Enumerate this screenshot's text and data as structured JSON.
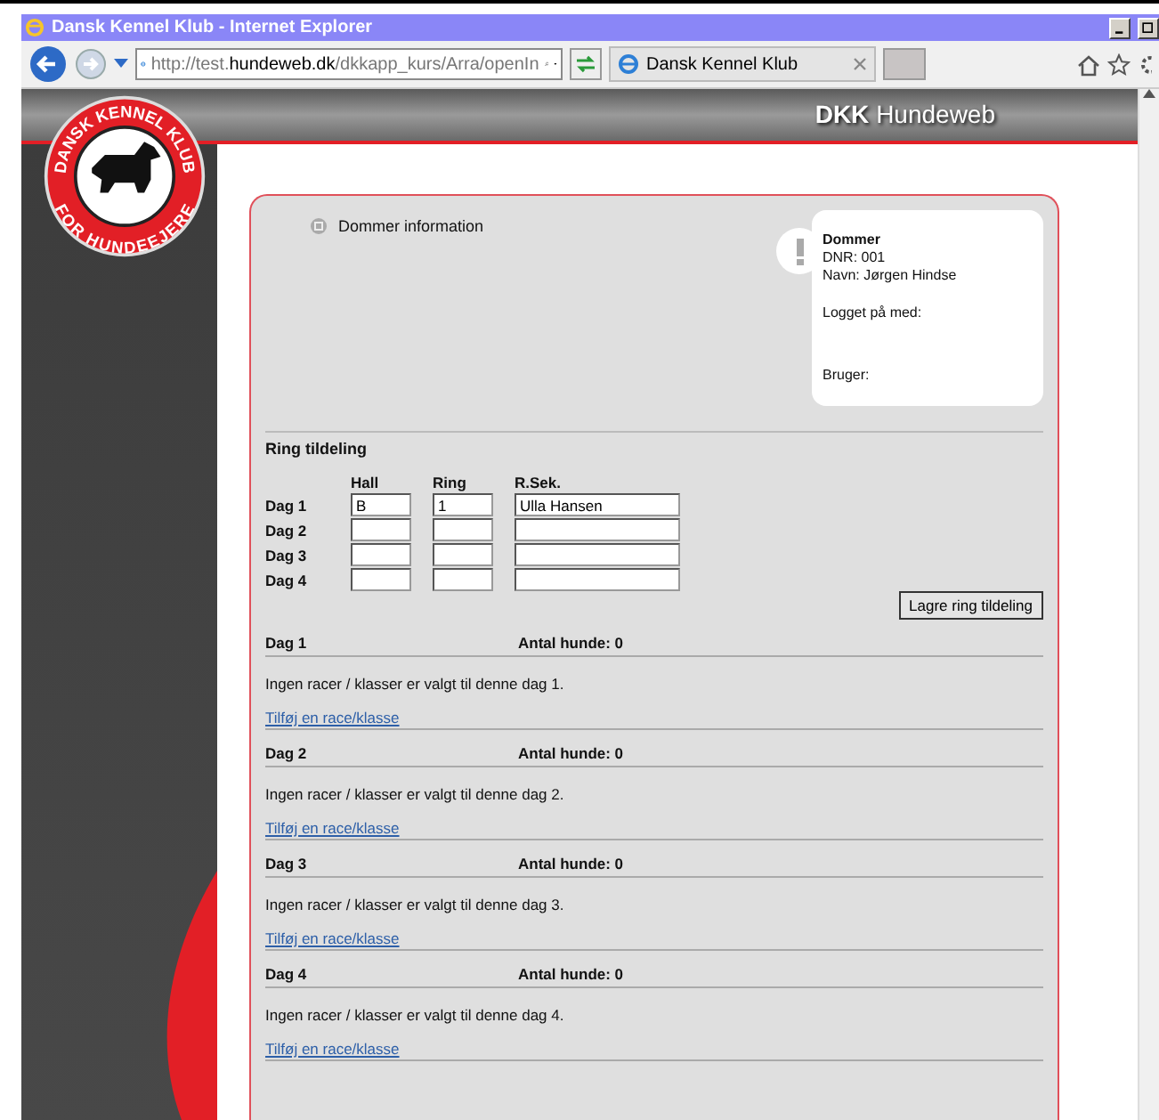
{
  "window": {
    "title": "Dansk Kennel Klub - Internet Explorer"
  },
  "address": {
    "scheme": "http://test.",
    "host": "hundeweb.dk",
    "path": "/dkkapp_kurs/Arra/openIn"
  },
  "tabs": [
    {
      "label": "Dansk Kennel Klub",
      "selected": true
    }
  ],
  "logo": {
    "top": "DANSK KENNEL KLUB",
    "bottom": "FOR HUNDEEJERE"
  },
  "header": {
    "brand": "DKK",
    "title": "Hundeweb"
  },
  "section": {
    "title": "Dommer information"
  },
  "info_card": {
    "heading": "Dommer",
    "lines": [
      "DNR: 001",
      "Navn: Jørgen Hindse"
    ],
    "logged_label": "Logget på med:",
    "user_label": "Bruger:"
  },
  "ring": {
    "title": "Ring tildeling",
    "columns": [
      "Hall",
      "Ring",
      "R.Sek."
    ],
    "rows": [
      {
        "label": "Dag 1",
        "hall": "B",
        "ring": "1",
        "rsek": "Ulla Hansen"
      },
      {
        "label": "Dag 2",
        "hall": "",
        "ring": "",
        "rsek": ""
      },
      {
        "label": "Dag 3",
        "hall": "",
        "ring": "",
        "rsek": ""
      },
      {
        "label": "Dag 4",
        "hall": "",
        "ring": "",
        "rsek": ""
      }
    ],
    "button": "Lagre ring tildeling"
  },
  "days": [
    {
      "title": "Dag 1",
      "count": "Antal hunde: 0",
      "message": "Ingen racer / klasser er valgt til denne dag 1.",
      "link": "Tilføj en race/klasse"
    },
    {
      "title": "Dag 2",
      "count": "Antal hunde: 0",
      "message": "Ingen racer / klasser er valgt til denne dag 2.",
      "link": "Tilføj en race/klasse"
    },
    {
      "title": "Dag 3",
      "count": "Antal hunde: 0",
      "message": "Ingen racer / klasser er valgt til denne dag 3.",
      "link": "Tilføj en race/klasse"
    },
    {
      "title": "Dag 4",
      "count": "Antal hunde: 0",
      "message": "Ingen racer / klasser er valgt til denne dag 4.",
      "link": "Tilføj en race/klasse"
    }
  ]
}
